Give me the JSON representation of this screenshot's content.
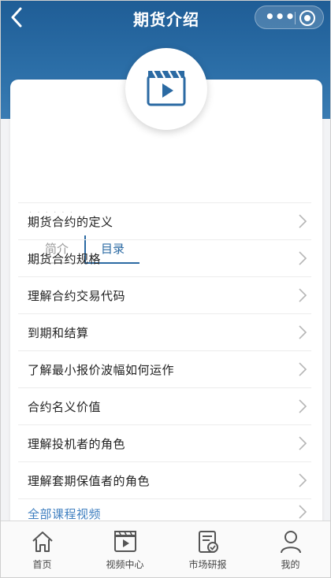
{
  "nav": {
    "title": "期货介绍",
    "back_icon": "chevron-left-icon",
    "more_icon": "more-dots-icon",
    "close_icon": "target-icon"
  },
  "hero": {
    "icon": "video-clapper-icon",
    "faint_text": "·  ·  ·  ·  ·  ·"
  },
  "tabs": [
    {
      "label": "简介",
      "active": false
    },
    {
      "label": "目录",
      "active": true
    }
  ],
  "list": {
    "items": [
      "期货合约的定义",
      "期货合约规格",
      "理解合约交易代码",
      "到期和结算",
      "了解最小报价波幅如何运作",
      "合约名义价值",
      "理解投机者的角色",
      "理解套期保值者的角色"
    ],
    "all_link": "全部课程视频"
  },
  "tabbar": [
    {
      "label": "首页",
      "icon": "home-icon"
    },
    {
      "label": "视频中心",
      "icon": "video-icon"
    },
    {
      "label": "市场研报",
      "icon": "report-icon"
    },
    {
      "label": "我的",
      "icon": "user-icon"
    }
  ],
  "colors": {
    "header": "#2c6fa8",
    "accent": "#2b6aa3",
    "link": "#3f7fc0"
  }
}
